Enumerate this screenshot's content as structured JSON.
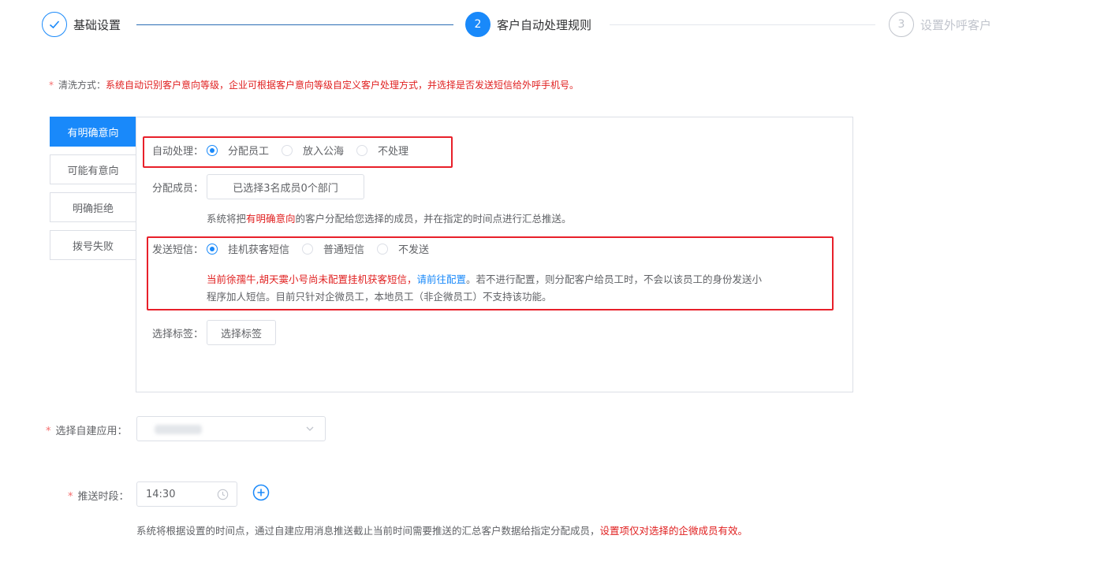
{
  "steps": [
    {
      "number": "1",
      "title": "基础设置",
      "state": "done"
    },
    {
      "number": "2",
      "title": "客户自动处理规则",
      "state": "active"
    },
    {
      "number": "3",
      "title": "设置外呼客户",
      "state": "wait"
    }
  ],
  "clean": {
    "star": "*",
    "label": "清洗方式：",
    "text": "系统自动识别客户意向等级，企业可根据客户意向等级自定义客户处理方式，并选择是否发送短信给外呼手机号。"
  },
  "tabs": [
    "有明确意向",
    "可能有意向",
    "明确拒绝",
    "拨号失败"
  ],
  "auto_process": {
    "label": "自动处理：",
    "options": [
      "分配员工",
      "放入公海",
      "不处理"
    ],
    "selected": "分配员工"
  },
  "assign": {
    "label": "分配成员：",
    "button": "已选择3名成员0个部门",
    "note_prefix": "系统将把",
    "note_highlight": "有明确意向",
    "note_suffix": "的客户分配给您选择的成员，并在指定的时间点进行汇总推送。"
  },
  "sms": {
    "label": "发送短信：",
    "options": [
      "挂机获客短信",
      "普通短信",
      "不发送"
    ],
    "selected": "挂机获客短信",
    "warning_red": "当前徐孺牛,胡天霙小号尚未配置挂机获客短信，",
    "warning_link": "请前往配置",
    "warning_line1_rest": "。若不进行配置，则分配客户给员工时，不会以该员工的身份发送小",
    "warning_line2": "程序加人短信。目前只针对企微员工，本地员工（非企微员工）不支持该功能。"
  },
  "tags": {
    "label": "选择标签：",
    "button": "选择标签"
  },
  "app": {
    "star": "*",
    "label": "选择自建应用："
  },
  "push": {
    "star": "*",
    "label": "推送时段：",
    "time": "14:30",
    "note_normal": "系统将根据设置的时间点，通过自建应用消息推送截止当前时间需要推送的汇总客户数据给指定分配成员，",
    "note_red": "设置项仅对选择的企微成员有效。"
  },
  "colors": {
    "primary": "#1989fa",
    "danger": "#e02020",
    "highlight_border": "#e8202a"
  }
}
